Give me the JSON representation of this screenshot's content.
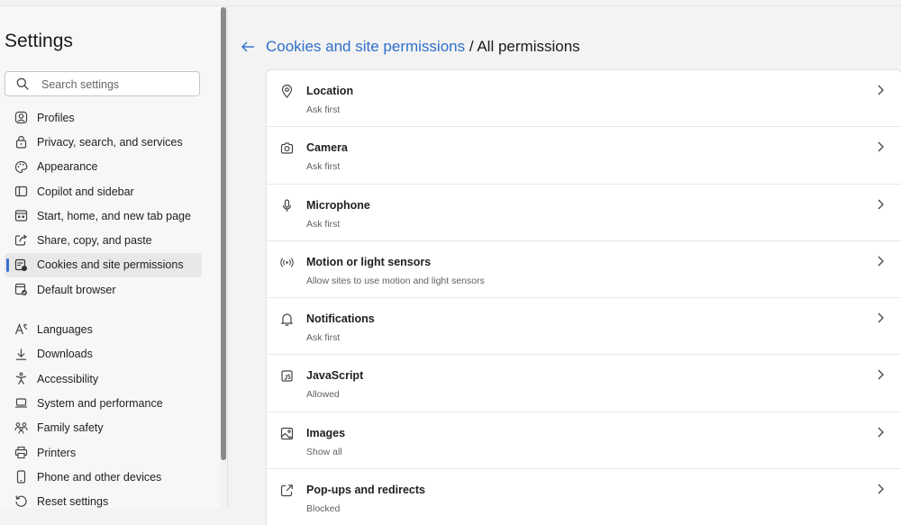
{
  "sidebar": {
    "title": "Settings",
    "search_placeholder": "Search settings",
    "items": [
      {
        "label": "Profiles",
        "icon": "profile-icon"
      },
      {
        "label": "Privacy, search, and services",
        "icon": "lock-icon"
      },
      {
        "label": "Appearance",
        "icon": "palette-icon"
      },
      {
        "label": "Copilot and sidebar",
        "icon": "sidebar-icon"
      },
      {
        "label": "Start, home, and new tab page",
        "icon": "home-tab-icon"
      },
      {
        "label": "Share, copy, and paste",
        "icon": "share-icon"
      },
      {
        "label": "Cookies and site permissions",
        "icon": "cookies-icon",
        "selected": true
      },
      {
        "label": "Default browser",
        "icon": "browser-icon"
      }
    ],
    "items2": [
      {
        "label": "Languages",
        "icon": "languages-icon"
      },
      {
        "label": "Downloads",
        "icon": "download-icon"
      },
      {
        "label": "Accessibility",
        "icon": "accessibility-icon"
      },
      {
        "label": "System and performance",
        "icon": "laptop-icon"
      },
      {
        "label": "Family safety",
        "icon": "family-icon"
      },
      {
        "label": "Printers",
        "icon": "printer-icon"
      },
      {
        "label": "Phone and other devices",
        "icon": "phone-icon"
      },
      {
        "label": "Reset settings",
        "icon": "reset-icon"
      }
    ]
  },
  "main": {
    "breadcrumb_parent": "Cookies and site permissions",
    "breadcrumb_sep": " / ",
    "breadcrumb_current": "All permissions",
    "permissions": [
      {
        "title": "Location",
        "subtitle": "Ask first",
        "icon": "location-icon"
      },
      {
        "title": "Camera",
        "subtitle": "Ask first",
        "icon": "camera-icon"
      },
      {
        "title": "Microphone",
        "subtitle": "Ask first",
        "icon": "microphone-icon"
      },
      {
        "title": "Motion or light sensors",
        "subtitle": "Allow sites to use motion and light sensors",
        "icon": "sensor-icon"
      },
      {
        "title": "Notifications",
        "subtitle": "Ask first",
        "icon": "bell-icon"
      },
      {
        "title": "JavaScript",
        "subtitle": "Allowed",
        "icon": "javascript-icon"
      },
      {
        "title": "Images",
        "subtitle": "Show all",
        "icon": "image-icon"
      },
      {
        "title": "Pop-ups and redirects",
        "subtitle": "Blocked",
        "icon": "popup-icon"
      }
    ]
  },
  "colors": {
    "accent": "#2f6fcb",
    "selection_bar": "#3b6fd6"
  }
}
